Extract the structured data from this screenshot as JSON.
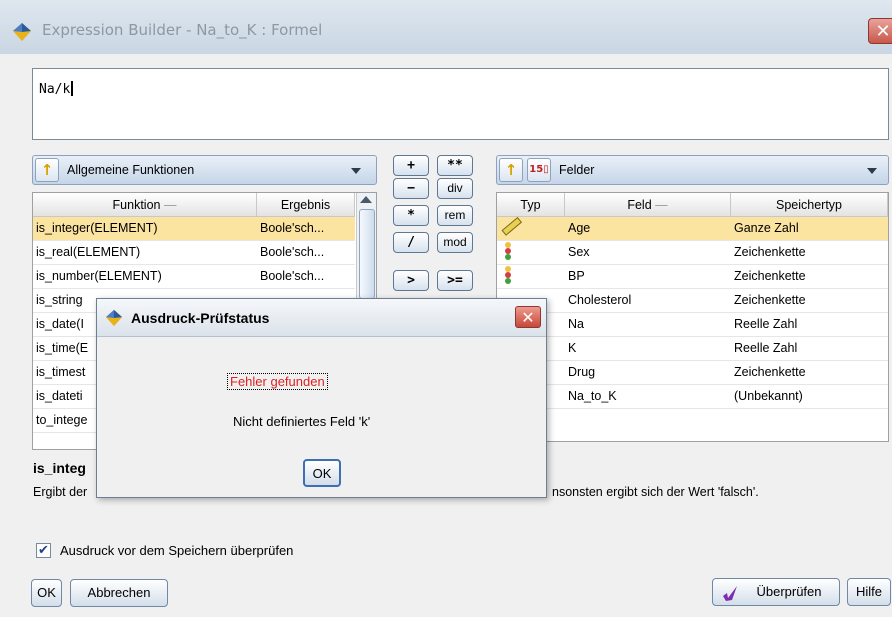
{
  "window": {
    "title": "Expression Builder - Na_to_K : Formel",
    "close_glyph": "✕"
  },
  "expression": {
    "value": "Na/k"
  },
  "functions": {
    "category": "Allgemeine Funktionen",
    "columns": [
      "Funktion",
      "Ergebnis"
    ],
    "rows": [
      {
        "name": "is_integer(ELEMENT)",
        "result": "Boole'sch..."
      },
      {
        "name": "is_real(ELEMENT)",
        "result": "Boole'sch..."
      },
      {
        "name": "is_number(ELEMENT)",
        "result": "Boole'sch..."
      },
      {
        "name": "is_string",
        "result": ""
      },
      {
        "name": "is_date(I",
        "result": ""
      },
      {
        "name": "is_time(E",
        "result": ""
      },
      {
        "name": "is_timest",
        "result": ""
      },
      {
        "name": "is_dateti",
        "result": ""
      },
      {
        "name": "to_intege",
        "result": ""
      }
    ]
  },
  "operators": {
    "rows": [
      [
        "+",
        "**"
      ],
      [
        "−",
        "div"
      ],
      [
        "*",
        "rem"
      ],
      [
        "/",
        "mod"
      ],
      [
        ">",
        ">="
      ]
    ]
  },
  "fields": {
    "category": "Felder",
    "columns": [
      "Typ",
      "Feld",
      "Speichertyp"
    ],
    "rows": [
      {
        "icon": "ruler-icon",
        "field": "Age",
        "storage": "Ganze Zahl"
      },
      {
        "icon": "set-icon",
        "field": "Sex",
        "storage": "Zeichenkette"
      },
      {
        "icon": "set-icon",
        "field": "BP",
        "storage": "Zeichenkette"
      },
      {
        "icon": "",
        "field": "Cholesterol",
        "storage": "Zeichenkette"
      },
      {
        "icon": "",
        "field": "Na",
        "storage": "Reelle Zahl"
      },
      {
        "icon": "",
        "field": "K",
        "storage": "Reelle Zahl"
      },
      {
        "icon": "",
        "field": "Drug",
        "storage": "Zeichenkette"
      },
      {
        "icon": "",
        "field": "Na_to_K",
        "storage": "(Unbekannt)"
      }
    ]
  },
  "description": {
    "title": "is_integ",
    "text_left": "Ergibt der",
    "text_right": "nsonsten ergibt sich der Wert 'falsch'."
  },
  "checkbox": {
    "label": "Ausdruck vor dem Speichern überprüfen",
    "checked": true,
    "mark": "✔"
  },
  "buttons": {
    "ok": "OK",
    "cancel": "Abbrechen",
    "check": "Überprüfen",
    "help": "Hilfe"
  },
  "dialog": {
    "title": "Ausdruck-Prüfstatus",
    "error": "Fehler gefunden",
    "message": "Nicht definiertes Feld 'k'",
    "ok": "OK",
    "close_glyph": "✕"
  },
  "colors": {
    "error_text": "#e02020",
    "selection": "#fbe3a0",
    "accent": "#d9a000"
  }
}
